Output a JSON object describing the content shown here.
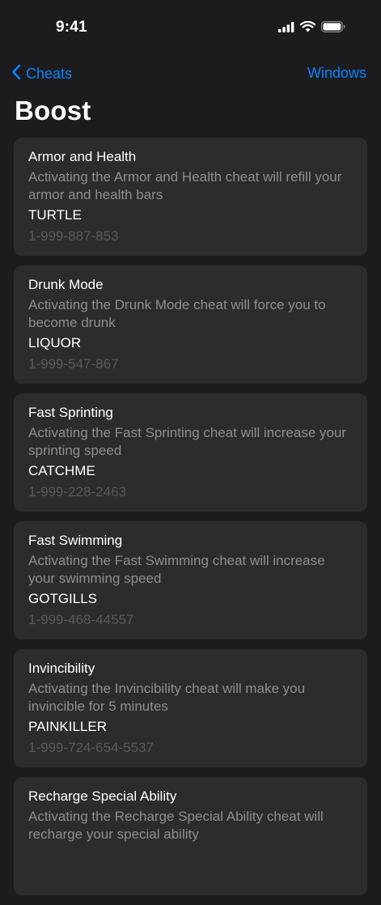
{
  "status_bar": {
    "time": "9:41"
  },
  "nav": {
    "back_label": "Cheats",
    "right_label": "Windows"
  },
  "page": {
    "title": "Boost"
  },
  "icons": {
    "back": "chevron-left-icon",
    "signal": "cellular-signal-icon",
    "wifi": "wifi-icon",
    "battery": "battery-icon"
  },
  "colors": {
    "background": "#1c1c1e",
    "card": "#2c2c2e",
    "accent": "#0a84ff",
    "secondary_text": "#8e8e93",
    "tertiary_text": "#5a5a5e"
  },
  "cheats": [
    {
      "title": "Armor and Health",
      "description": "Activating the Armor and Health cheat will refill your armor and health bars",
      "code": "TURTLE",
      "phone": "1-999-887-853"
    },
    {
      "title": "Drunk Mode",
      "description": "Activating the Drunk Mode cheat will force you to become drunk",
      "code": "LIQUOR",
      "phone": "1-999-547-867"
    },
    {
      "title": "Fast Sprinting",
      "description": "Activating the Fast Sprinting cheat will increase your sprinting speed",
      "code": "CATCHME",
      "phone": "1-999-228-2463"
    },
    {
      "title": "Fast Swimming",
      "description": "Activating the Fast Swimming cheat will increase your swimming speed",
      "code": "GOTGILLS",
      "phone": "1-999-468-44557"
    },
    {
      "title": "Invincibility",
      "description": "Activating the Invincibility cheat will make you invincible for 5 minutes",
      "code": "PAINKILLER",
      "phone": "1-999-724-654-5537"
    },
    {
      "title": "Recharge Special Ability",
      "description": "Activating the Recharge Special Ability cheat will recharge your special ability",
      "code": "",
      "phone": ""
    }
  ]
}
